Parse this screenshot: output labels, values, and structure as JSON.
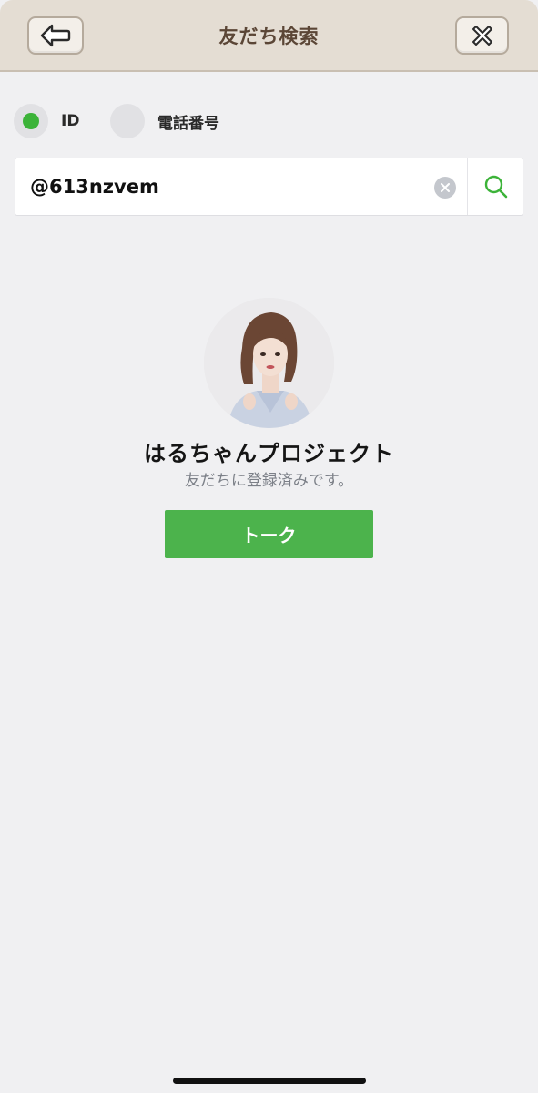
{
  "header": {
    "title": "友だち検索",
    "back_icon": "back-arrow-icon",
    "close_icon": "close-icon"
  },
  "search_type": {
    "options": [
      {
        "label": "ID",
        "selected": true
      },
      {
        "label": "電話番号",
        "selected": false
      }
    ],
    "selected_color": "#3cb339"
  },
  "search": {
    "value": "@613nzvem",
    "clear_icon": "clear-icon",
    "search_icon": "search-icon"
  },
  "result": {
    "name": "はるちゃんプロジェクト",
    "status": "友だちに登録済みです。",
    "talk_label": "トーク",
    "talk_color": "#4cb34c"
  },
  "colors": {
    "header_bg": "#e4ddd3",
    "title": "#5b4636",
    "page_bg": "#f0f0f2",
    "accent": "#3cb339"
  }
}
